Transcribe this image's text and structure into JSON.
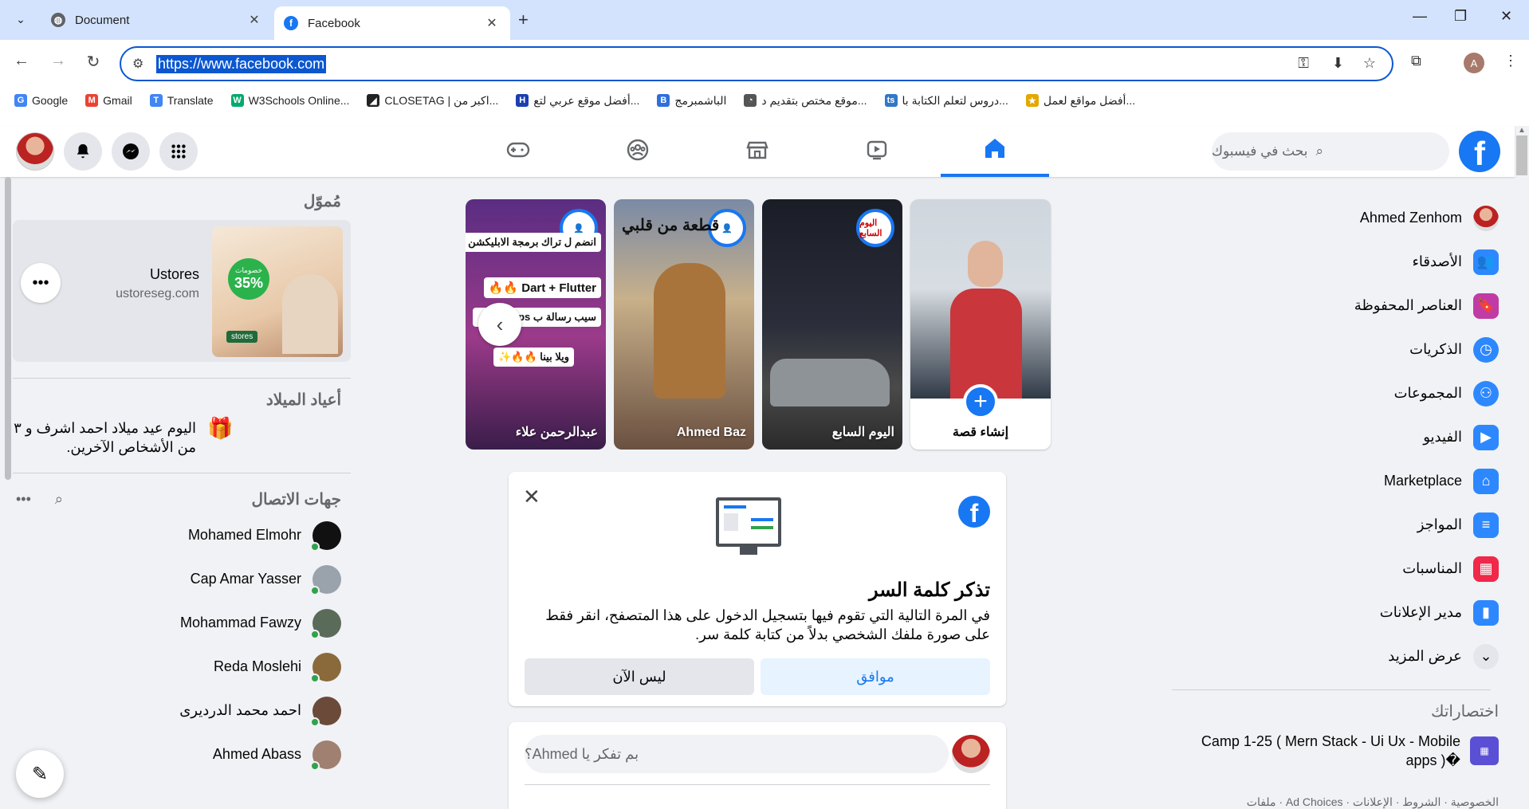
{
  "browser": {
    "tabs": [
      {
        "title": "Document",
        "favicon": "globe-icon"
      },
      {
        "title": "Facebook",
        "favicon": "facebook-icon"
      }
    ],
    "url": "https://www.facebook.com",
    "profile_initial": "A",
    "bookmarks": [
      {
        "label": "Google",
        "icon": "G",
        "color": "#4285f4"
      },
      {
        "label": "Gmail",
        "icon": "M",
        "color": "#ea4335"
      },
      {
        "label": "Translate",
        "icon": "T",
        "color": "#4285f4"
      },
      {
        "label": "W3Schools Online...",
        "icon": "W",
        "color": "#04aa6d"
      },
      {
        "label": "CLOSETAG | اكبر من...",
        "icon": "◢",
        "color": "#222222"
      },
      {
        "label": "أفضل موقع عربي لتع...",
        "icon": "H",
        "color": "#1a3fb0"
      },
      {
        "label": "الباشمبرمج",
        "icon": "B",
        "color": "#2f6fdc"
      },
      {
        "label": "موقع مختص بتقديم د...",
        "icon": "◔",
        "color": "#555555"
      },
      {
        "label": "دروس لتعلم الكتابة با...",
        "icon": "ts",
        "color": "#3178c6"
      },
      {
        "label": "أفضل مواقع لعمل...",
        "icon": "★",
        "color": "#e3a800"
      }
    ]
  },
  "fb": {
    "brand_color": "#1877f2",
    "search_placeholder": "بحث في فيسبوك",
    "logo_letter": "f",
    "right_nav": [
      {
        "label": "Ahmed Zenhom",
        "icon": "profile-avatar"
      },
      {
        "label": "الأصدقاء",
        "icon": "friends-icon"
      },
      {
        "label": "العناصر المحفوظة",
        "icon": "bookmark-icon"
      },
      {
        "label": "الذكريات",
        "icon": "clock-icon"
      },
      {
        "label": "المجموعات",
        "icon": "groups-icon"
      },
      {
        "label": "الفيديو",
        "icon": "video-icon"
      },
      {
        "label": "Marketplace",
        "icon": "store-icon"
      },
      {
        "label": "المواجز",
        "icon": "feeds-icon"
      },
      {
        "label": "المناسبات",
        "icon": "calendar-icon"
      },
      {
        "label": "مدير الإعلانات",
        "icon": "chart-icon"
      },
      {
        "label": "عرض المزيد",
        "icon": "chevron-down-icon"
      }
    ],
    "shortcuts_title": "اختصاراتك",
    "shortcut": {
      "label": "Camp 1-25 ( Mern Stack - Ui Ux - Mobile apps )�"
    },
    "footer": "الخصوصية · الشروط · الإعلانات · Ad Choices · ملفات"
  },
  "left": {
    "sponsored_title": "مُموّل",
    "ad": {
      "name": "Ustores",
      "domain": "ustoreseg.com",
      "badge": "35%",
      "badge_caption": "خصومات",
      "logo": "stores"
    },
    "birthdays_title": "أعياد الميلاد",
    "birthday_text": "اليوم عيد ميلاد احمد اشرف و ٣ من الأشخاص الآخرين.",
    "contacts_title": "جهات الاتصال",
    "contacts": [
      {
        "name": "Mohamed Elmohr",
        "color": "#111111"
      },
      {
        "name": "Cap Amar Yasser",
        "color": "#9aa3ab"
      },
      {
        "name": "Mohammad Fawzy",
        "color": "#5b6b5a"
      },
      {
        "name": "Reda Moslehi",
        "color": "#8a6a3a"
      },
      {
        "name": "احمد محمد الدرديرى",
        "color": "#6b4a3a"
      },
      {
        "name": "Ahmed Abass",
        "color": "#a08070"
      }
    ]
  },
  "stories": {
    "create_label": "إنشاء قصة",
    "items": [
      {
        "name": "اليوم السابع",
        "badge": "اليوم السابع"
      },
      {
        "name": "Ahmed Baz",
        "overlay": "قطعة من قلبي"
      },
      {
        "name": "عبدالرحمن علاء",
        "promo": [
          "انضم ل تراك برمجة الابليكشن ✅",
          "Dart + Flutter 🔥🔥",
          "سيب رسالة ب apps 💯🔥",
          "ويلا بينا 🔥🔥✨"
        ]
      }
    ]
  },
  "password_card": {
    "title": "تذكر كلمة السر",
    "text": "في المرة التالية التي تقوم فيها بتسجيل الدخول على هذا المتصفح، انقر فقط على صورة ملفك الشخصي بدلاً من كتابة كلمة سر.",
    "confirm_label": "موافق",
    "dismiss_label": "ليس الآن"
  },
  "composer": {
    "placeholder": "بم تفكر يا Ahmed؟"
  }
}
